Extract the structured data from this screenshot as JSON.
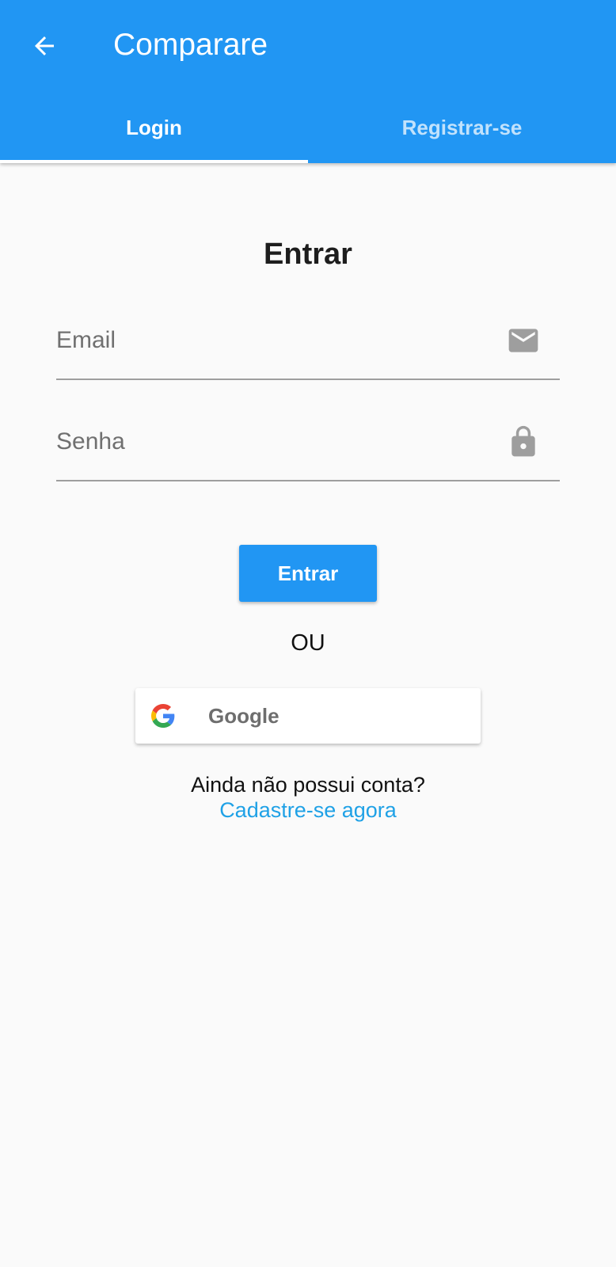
{
  "appbar": {
    "title": "Comparare",
    "back_icon": "arrow-back-icon",
    "background_color": "#2196f3"
  },
  "tabs": [
    {
      "label": "Login",
      "active": true
    },
    {
      "label": "Registrar-se",
      "active": false
    }
  ],
  "form": {
    "heading": "Entrar",
    "email": {
      "placeholder": "Email",
      "value": "",
      "icon": "mail-icon"
    },
    "password": {
      "placeholder": "Senha",
      "value": "",
      "icon": "lock-icon"
    },
    "submit_label": "Entrar"
  },
  "divider_text": "OU",
  "google": {
    "label": "Google",
    "icon": "google-icon"
  },
  "signup": {
    "prompt": "Ainda não possui conta?",
    "link": "Cadastre-se agora",
    "link_color": "#1fa1e6"
  }
}
